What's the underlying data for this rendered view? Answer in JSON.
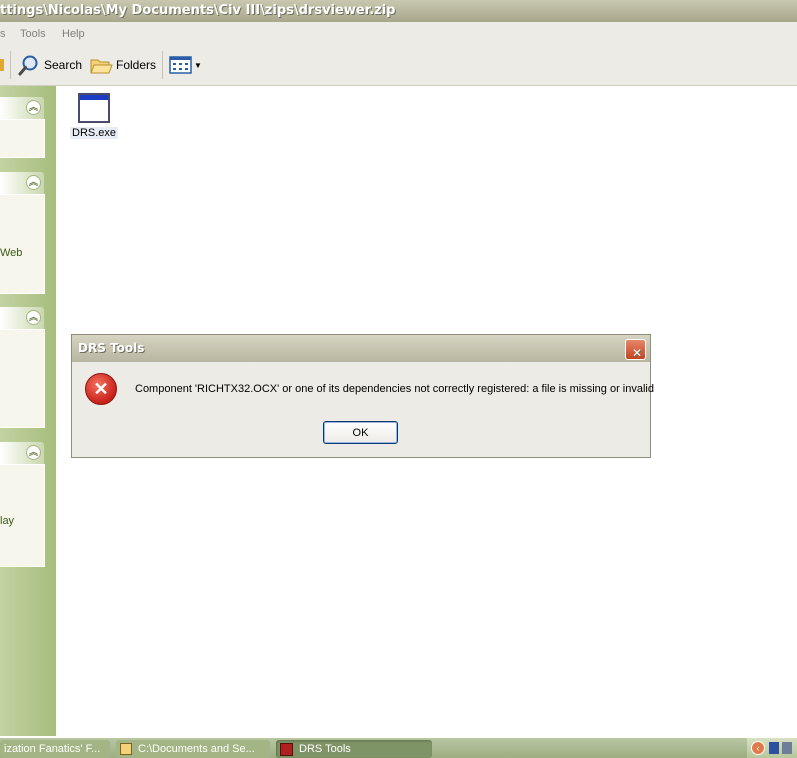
{
  "window": {
    "title": "ttings\\Nicolas\\My Documents\\Civ III\\zips\\drsviewer.zip"
  },
  "menu": {
    "items": [
      "s",
      "Tools",
      "Help"
    ]
  },
  "toolbar": {
    "search_label": "Search",
    "folders_label": "Folders"
  },
  "taskpane": {
    "partial_texts": [
      "Web",
      "lay"
    ]
  },
  "files": [
    {
      "name": "DRS.exe",
      "icon": "application-icon"
    }
  ],
  "dialog": {
    "title": "DRS Tools",
    "message": "Component 'RICHTX32.OCX' or one of its dependencies not correctly registered: a file is missing or invalid",
    "ok_label": "OK",
    "icon": "error-icon"
  },
  "taskbar": {
    "tasks": [
      {
        "label": "ization Fanatics' F..."
      },
      {
        "label": "C:\\Documents and Se..."
      },
      {
        "label": "DRS Tools"
      }
    ]
  },
  "colors": {
    "xp_olive_pane": "#a6bd7d",
    "dialog_bg": "#ecebe5",
    "close_red": "#c4441e"
  }
}
